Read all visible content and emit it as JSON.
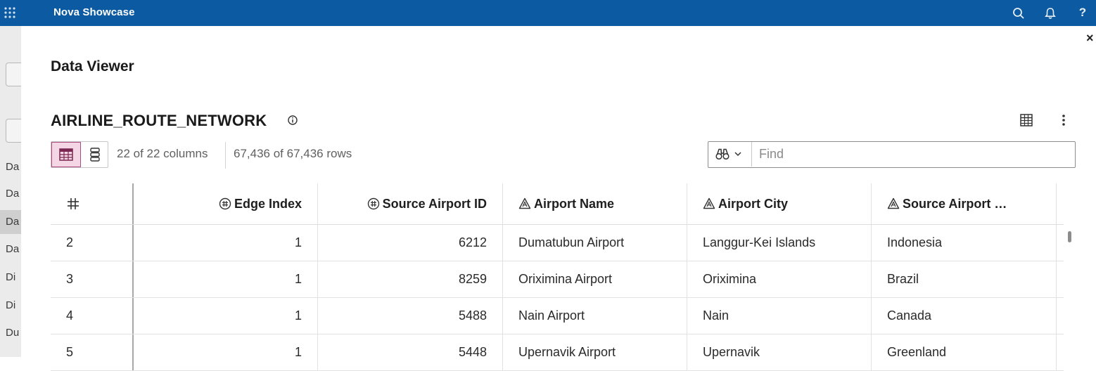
{
  "app": {
    "title": "Nova Showcase"
  },
  "background_sidebar": {
    "items": [
      "Da",
      "Da",
      "Da",
      "Da",
      "Di",
      "Di",
      "Du"
    ]
  },
  "modal": {
    "title": "Data Viewer",
    "close_label": "×",
    "help_label": "?"
  },
  "table_info": {
    "name": "AIRLINE_ROUTE_NETWORK",
    "columns_count": "22 of 22 columns",
    "rows_count": "67,436 of 67,436 rows"
  },
  "find": {
    "placeholder": "Find"
  },
  "table": {
    "headers": [
      {
        "label": "",
        "icon": "hash-icon"
      },
      {
        "label": "Edge Index",
        "icon": "numeric-column-icon"
      },
      {
        "label": "Source Airport ID",
        "icon": "numeric-column-icon"
      },
      {
        "label": "Airport Name",
        "icon": "character-column-icon"
      },
      {
        "label": "Airport City",
        "icon": "character-column-icon"
      },
      {
        "label": "Source Airport …",
        "icon": "character-column-icon"
      }
    ],
    "rows": [
      [
        "2",
        "1",
        "6212",
        "Dumatubun Airport",
        "Langgur-Kei Islands",
        "Indonesia"
      ],
      [
        "3",
        "1",
        "8259",
        "Oriximina Airport",
        "Oriximina",
        "Brazil"
      ],
      [
        "4",
        "1",
        "5488",
        "Nain Airport",
        "Nain",
        "Canada"
      ],
      [
        "5",
        "1",
        "5448",
        "Upernavik Airport",
        "Upernavik",
        "Greenland"
      ]
    ]
  },
  "colors": {
    "topbar": "#0b5aa2",
    "toggle_active_bg": "#f4d6e4",
    "toggle_active_border": "#b04b7f"
  }
}
